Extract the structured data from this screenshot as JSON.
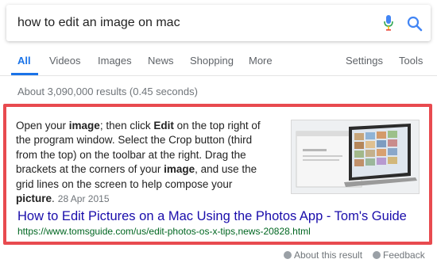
{
  "search": {
    "query": "how to edit an image on mac",
    "mic_icon": "mic-icon",
    "search_icon": "search-icon"
  },
  "tabs": {
    "items": [
      {
        "label": "All",
        "active": true
      },
      {
        "label": "Videos"
      },
      {
        "label": "Images"
      },
      {
        "label": "News"
      },
      {
        "label": "Shopping"
      },
      {
        "label": "More"
      }
    ],
    "settings": "Settings",
    "tools": "Tools"
  },
  "stats": "About 3,090,000 results (0.45 seconds)",
  "snippet": {
    "parts": [
      "Open your ",
      "image",
      "; then click ",
      "Edit",
      " on the top right of the program window. Select the Crop button (third from the top) on the toolbar at the right. Drag the brackets at the corners of your ",
      "image",
      ", and use the grid lines on the screen to help compose your ",
      "picture",
      "."
    ],
    "date": "28 Apr 2015",
    "highlight_color": "#e84a4f",
    "image_icon": "laptop-photos-thumbnail"
  },
  "result": {
    "title": "How to Edit Pictures on a Mac Using the Photos App - Tom's Guide",
    "url": "https://www.tomsguide.com/us/edit-photos-os-x-tips,news-20828.html"
  },
  "footer": {
    "about": "About this result",
    "feedback": "Feedback"
  }
}
